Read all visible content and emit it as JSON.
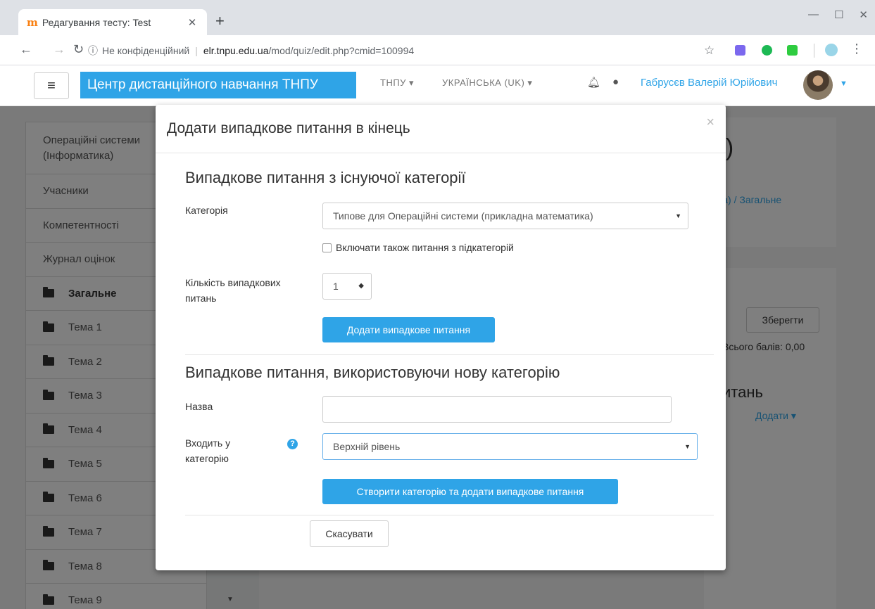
{
  "browser": {
    "tab_title": "Редагування тесту: Test",
    "tab_favicon": "ꟷ",
    "url_insecure": "Не конфіденційний",
    "url_host": "elr.tnpu.edu.ua",
    "url_path": "/mod/quiz/edit.php?cmid=100994",
    "icons": [
      "back-arrow-icon",
      "forward-arrow-icon",
      "reload-icon",
      "info-icon",
      "star-icon",
      "menu-dots-icon"
    ],
    "extension_colors": [
      "#7b68ee",
      "#1db954",
      "#2ecc40",
      "#9ad5e8"
    ]
  },
  "navbar": {
    "brand": "Центр дистанційного навчання ТНПУ",
    "menu1": "ТНПУ ▾",
    "menu2": "УКРАЇНСЬКА (UK) ▾",
    "user": "Габрусєв Валерій Юрійович",
    "accent": "#2fa4e7"
  },
  "drawer": {
    "items": [
      "Операційні системи (Інформатика)",
      "Учасники",
      "Компетентності",
      "Журнал оцінок",
      "Загальне",
      "Тема 1",
      "Тема 2",
      "Тема 3",
      "Тема 4",
      "Тема 5",
      "Тема 6",
      "Тема 7",
      "Тема 8",
      "Тема 9"
    ]
  },
  "background": {
    "title_fragment": "а)",
    "breadcrumb": "ика) / Загальне",
    "save": "Зберегти",
    "total": "Всього балів: 0,00",
    "questions": "итань",
    "add": "Додати ▾"
  },
  "modal": {
    "title": "Додати випадкове питання в кінець",
    "close": "×",
    "section1": {
      "title": "Випадкове питання з існуючої категорії",
      "category_label": "Категорія",
      "category_value": "Типове для Операційні системи (прикладна математика)",
      "include_sub_label": "Включати також питання з підкатегорій",
      "count_label": "Кількість випадкових питань",
      "count_value": "1",
      "add_button": "Додати випадкове питання"
    },
    "section2": {
      "title": "Випадкове питання, використовуючи нову категорію",
      "name_label": "Назва",
      "name_value": "",
      "parent_label": "Входить у категорію",
      "parent_value": "Верхній рівень",
      "create_button": "Створити категорію та додати випадкове питання"
    },
    "cancel_button": "Скасувати"
  }
}
